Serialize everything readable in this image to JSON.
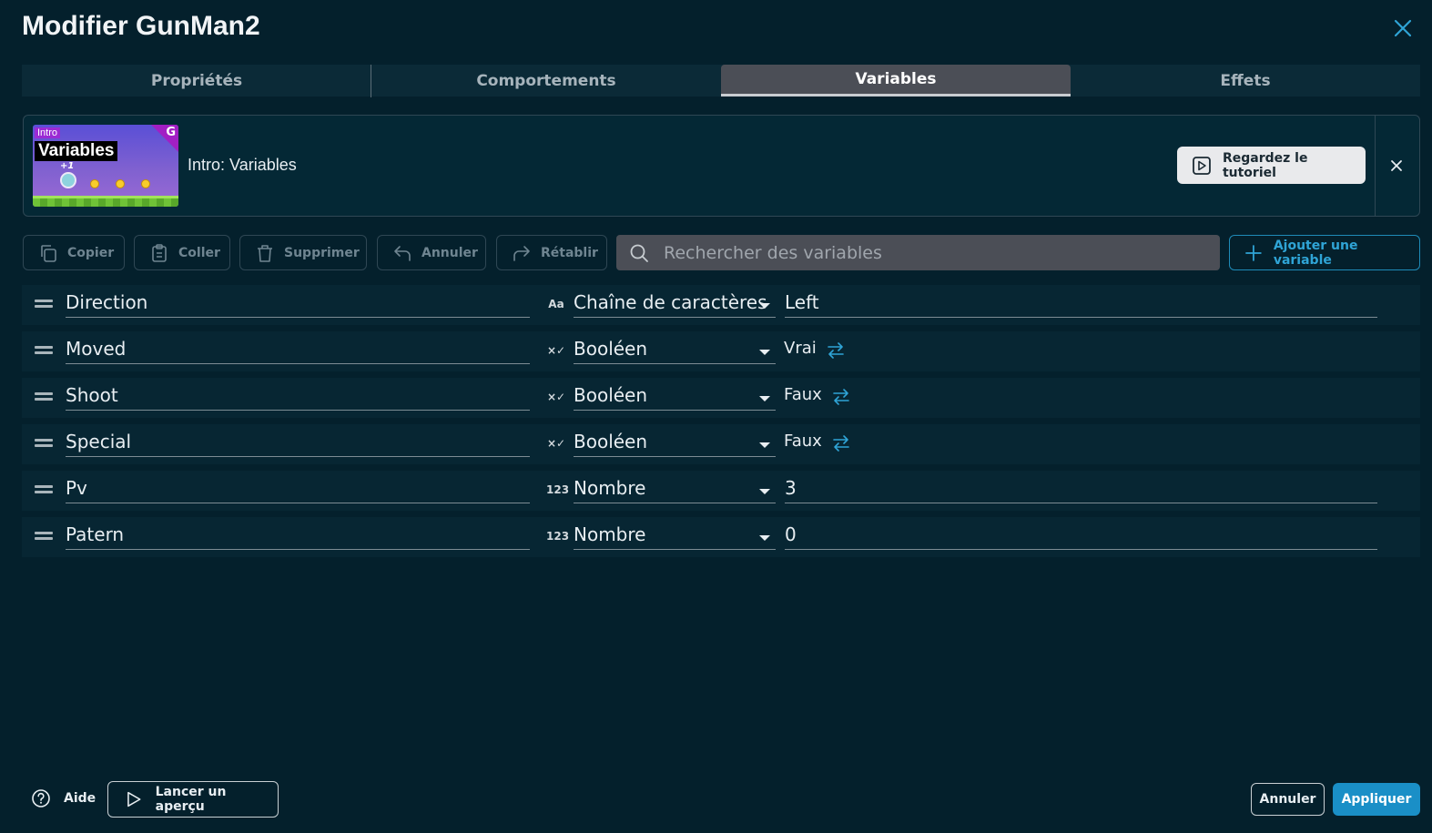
{
  "dialog": {
    "title": "Modifier GunMan2"
  },
  "tabs": [
    {
      "label": "Propriétés",
      "active": false
    },
    {
      "label": "Comportements",
      "active": false
    },
    {
      "label": "Variables",
      "active": true
    },
    {
      "label": "Effets",
      "active": false
    }
  ],
  "tutorial": {
    "thumbnail_tag": "Intro",
    "thumbnail_title": "Variables",
    "thumbnail_plus": "+1",
    "label": "Intro: Variables",
    "watch_label": "Regardez le tutoriel"
  },
  "toolbar": {
    "copy": "Copier",
    "paste": "Coller",
    "delete": "Supprimer",
    "undo": "Annuler",
    "redo": "Rétablir",
    "search_placeholder": "Rechercher des variables",
    "add": "Ajouter une variable"
  },
  "variables": [
    {
      "name": "Direction",
      "type_icon": "Aa",
      "type": "Chaîne de caractères",
      "value": "Left",
      "kind": "string"
    },
    {
      "name": "Moved",
      "type_icon": "×✓",
      "type": "Booléen",
      "value": "Vrai",
      "kind": "bool"
    },
    {
      "name": "Shoot",
      "type_icon": "×✓",
      "type": "Booléen",
      "value": "Faux",
      "kind": "bool"
    },
    {
      "name": "Special",
      "type_icon": "×✓",
      "type": "Booléen",
      "value": "Faux",
      "kind": "bool"
    },
    {
      "name": "Pv",
      "type_icon": "123",
      "type": "Nombre",
      "value": "3",
      "kind": "number"
    },
    {
      "name": "Patern",
      "type_icon": "123",
      "type": "Nombre",
      "value": "0",
      "kind": "number"
    }
  ],
  "footer": {
    "help": "Aide",
    "preview": "Lancer un aperçu",
    "cancel": "Annuler",
    "apply": "Appliquer"
  },
  "colors": {
    "background": "#04202c",
    "accent": "#1a8fc7",
    "swap_icon": "#2fa4d6"
  }
}
